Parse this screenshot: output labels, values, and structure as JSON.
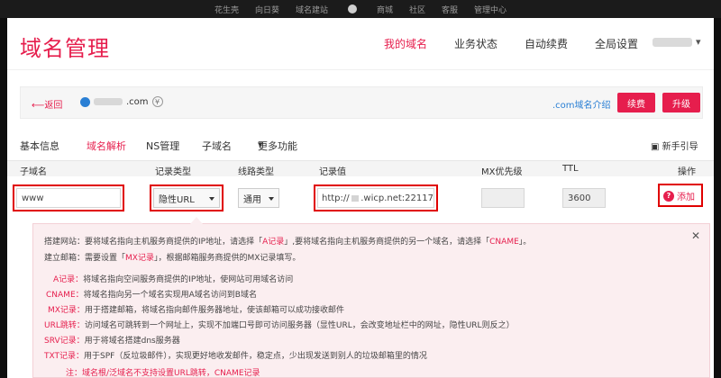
{
  "topnav": [
    "花生壳",
    "向日葵",
    "域名建站",
    "商城",
    "社区",
    "客服",
    "管理中心"
  ],
  "header": {
    "logo": "域名管理",
    "nav": [
      "我的域名",
      "业务状态",
      "自动续费",
      "全局设置"
    ]
  },
  "info": {
    "back": "返回",
    "domain_suffix": ".com",
    "intro_link": ".com域名介绍",
    "renew_button": "续费",
    "upgrade_button": "升级"
  },
  "tabs": {
    "items": [
      "基本信息",
      "域名解析",
      "NS管理",
      "子域名",
      "更多功能"
    ],
    "active": "域名解析",
    "guide": "新手引导"
  },
  "table": {
    "headers": [
      "子域名",
      "记录类型",
      "线路类型",
      "记录值",
      "MX优先级",
      "TTL",
      "操作"
    ],
    "row": {
      "subdomain": "www",
      "record_type": "隐性URL",
      "line": "通用",
      "value_prefix": "http://",
      "value_suffix": ".wicp.net:22117",
      "mx": "",
      "ttl": "3600",
      "action": "添加"
    }
  },
  "tips": {
    "line1": {
      "a": "搭建网站：要将域名指向主机服务商提供的IP地址，请选择「",
      "b": "A记录",
      "c": "」,要将域名指向主机服务商提供的另一个域名，请选择「",
      "d": "CNAME",
      "e": "」。"
    },
    "line2": {
      "a": "建立邮箱：需要设置「",
      "b": "MX记录",
      "c": "」，根据邮箱服务商提供的MX记录填写。"
    },
    "definitions": [
      {
        "key": "A记录：",
        "text": "将域名指向空间服务商提供的IP地址，使网站可用域名访问"
      },
      {
        "key": "CNAME：",
        "text": "将域名指向另一个域名实现用A域名访问到B域名"
      },
      {
        "key": "MX记录：",
        "text": "用于搭建邮箱，将域名指向邮件服务器地址，使该邮箱可以成功接收邮件"
      },
      {
        "key": "URL跳转：",
        "text": "访问域名可跳转到一个网址上，实现不加端口号即可访问服务器（显性URL，会改变地址栏中的网址，隐性URL则反之）"
      },
      {
        "key": "SRV记录：",
        "text": "用于将域名搭建dns服务器"
      },
      {
        "key": "TXT记录：",
        "text": "用于SPF（反垃圾邮件），实现更好地收发邮件，稳定点，少出现发送到别人的垃圾邮箱里的情况"
      }
    ],
    "note": "注：域名根/泛域名不支持设置URL跳转，CNAME记录"
  },
  "colors": {
    "accent": "#e61e4d",
    "highlight": "#e00000",
    "link": "#2a7fd4",
    "tip_bg": "#fbeef0"
  }
}
